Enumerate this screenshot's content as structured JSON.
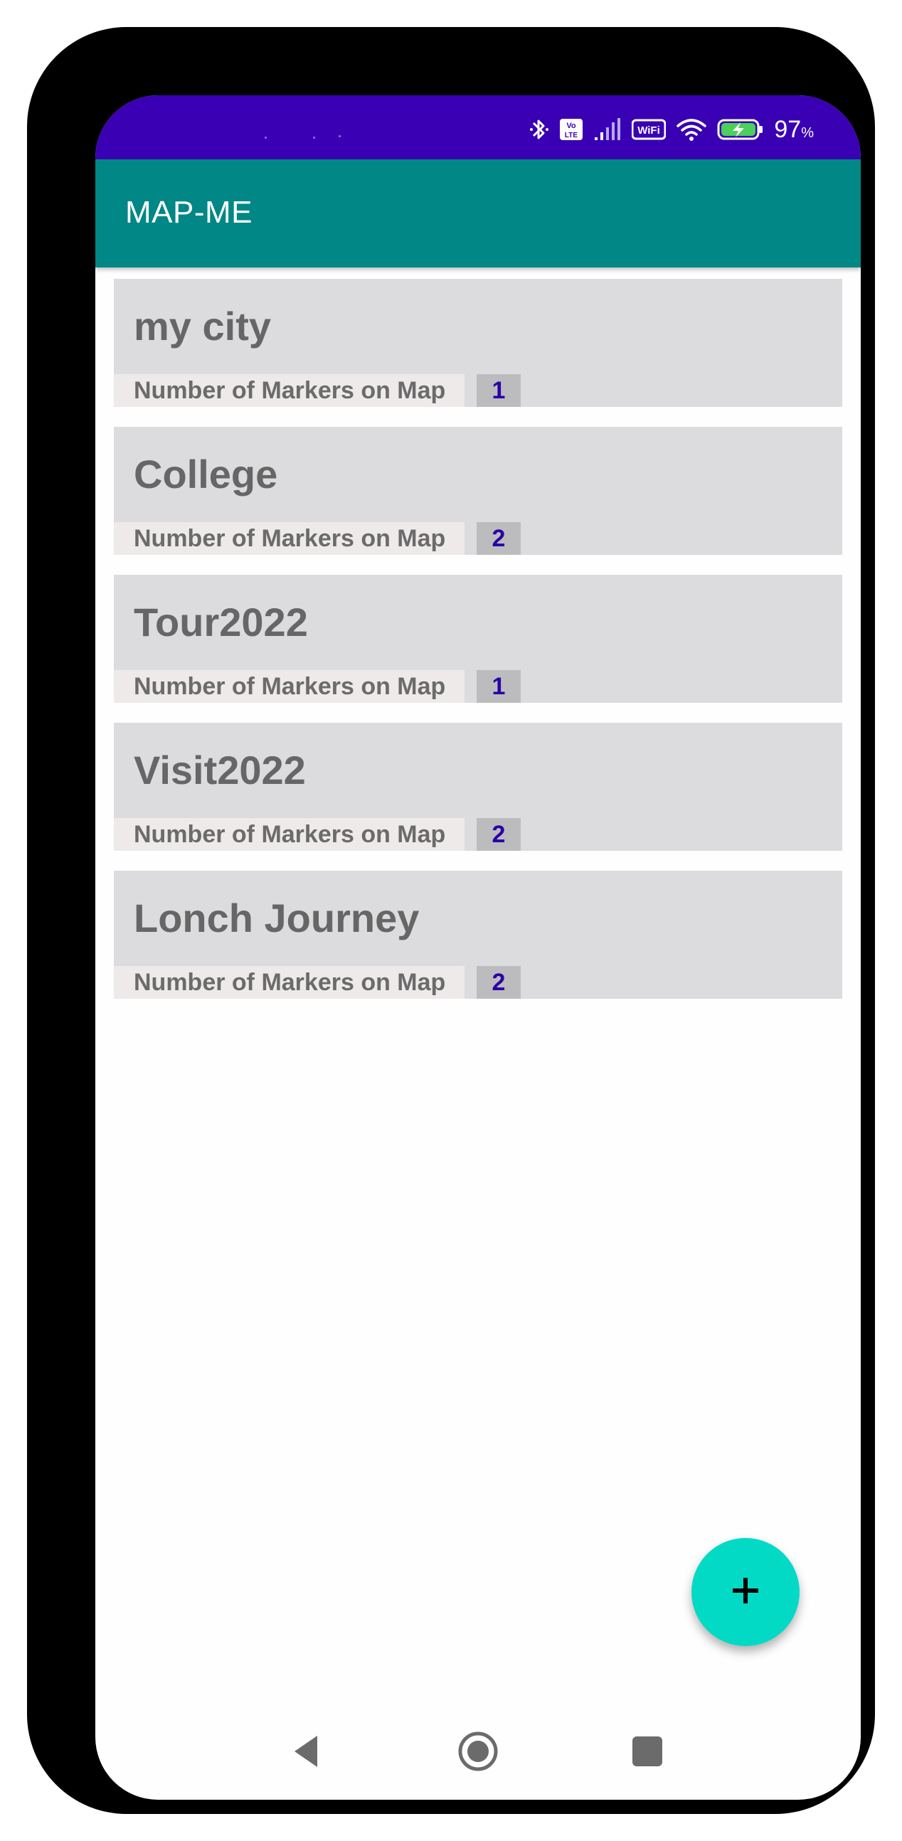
{
  "status_bar": {
    "battery_percent": "97",
    "battery_unit": "%",
    "icons": [
      "bluetooth-icon",
      "volte-icon",
      "signal-icon",
      "wifi-calling-icon",
      "wifi-icon",
      "battery-charging-icon"
    ],
    "background_color": "#3a00b3"
  },
  "app_bar": {
    "title": "MAP-ME",
    "background_color": "#008786"
  },
  "maps": [
    {
      "name": "my city",
      "marker_label": "Number of Markers on Map",
      "marker_count": "1"
    },
    {
      "name": "College",
      "marker_label": "Number of Markers on Map",
      "marker_count": "2"
    },
    {
      "name": "Tour2022",
      "marker_label": "Number of Markers on Map",
      "marker_count": "1"
    },
    {
      "name": "Visit2022",
      "marker_label": "Number of Markers on Map",
      "marker_count": "2"
    },
    {
      "name": "Lonch Journey",
      "marker_label": "Number of Markers on Map",
      "marker_count": "2"
    }
  ],
  "fab": {
    "icon": "plus-icon",
    "color": "#03dac5"
  },
  "nav_bar": {
    "buttons": [
      "back-icon",
      "home-icon",
      "recents-icon"
    ]
  }
}
